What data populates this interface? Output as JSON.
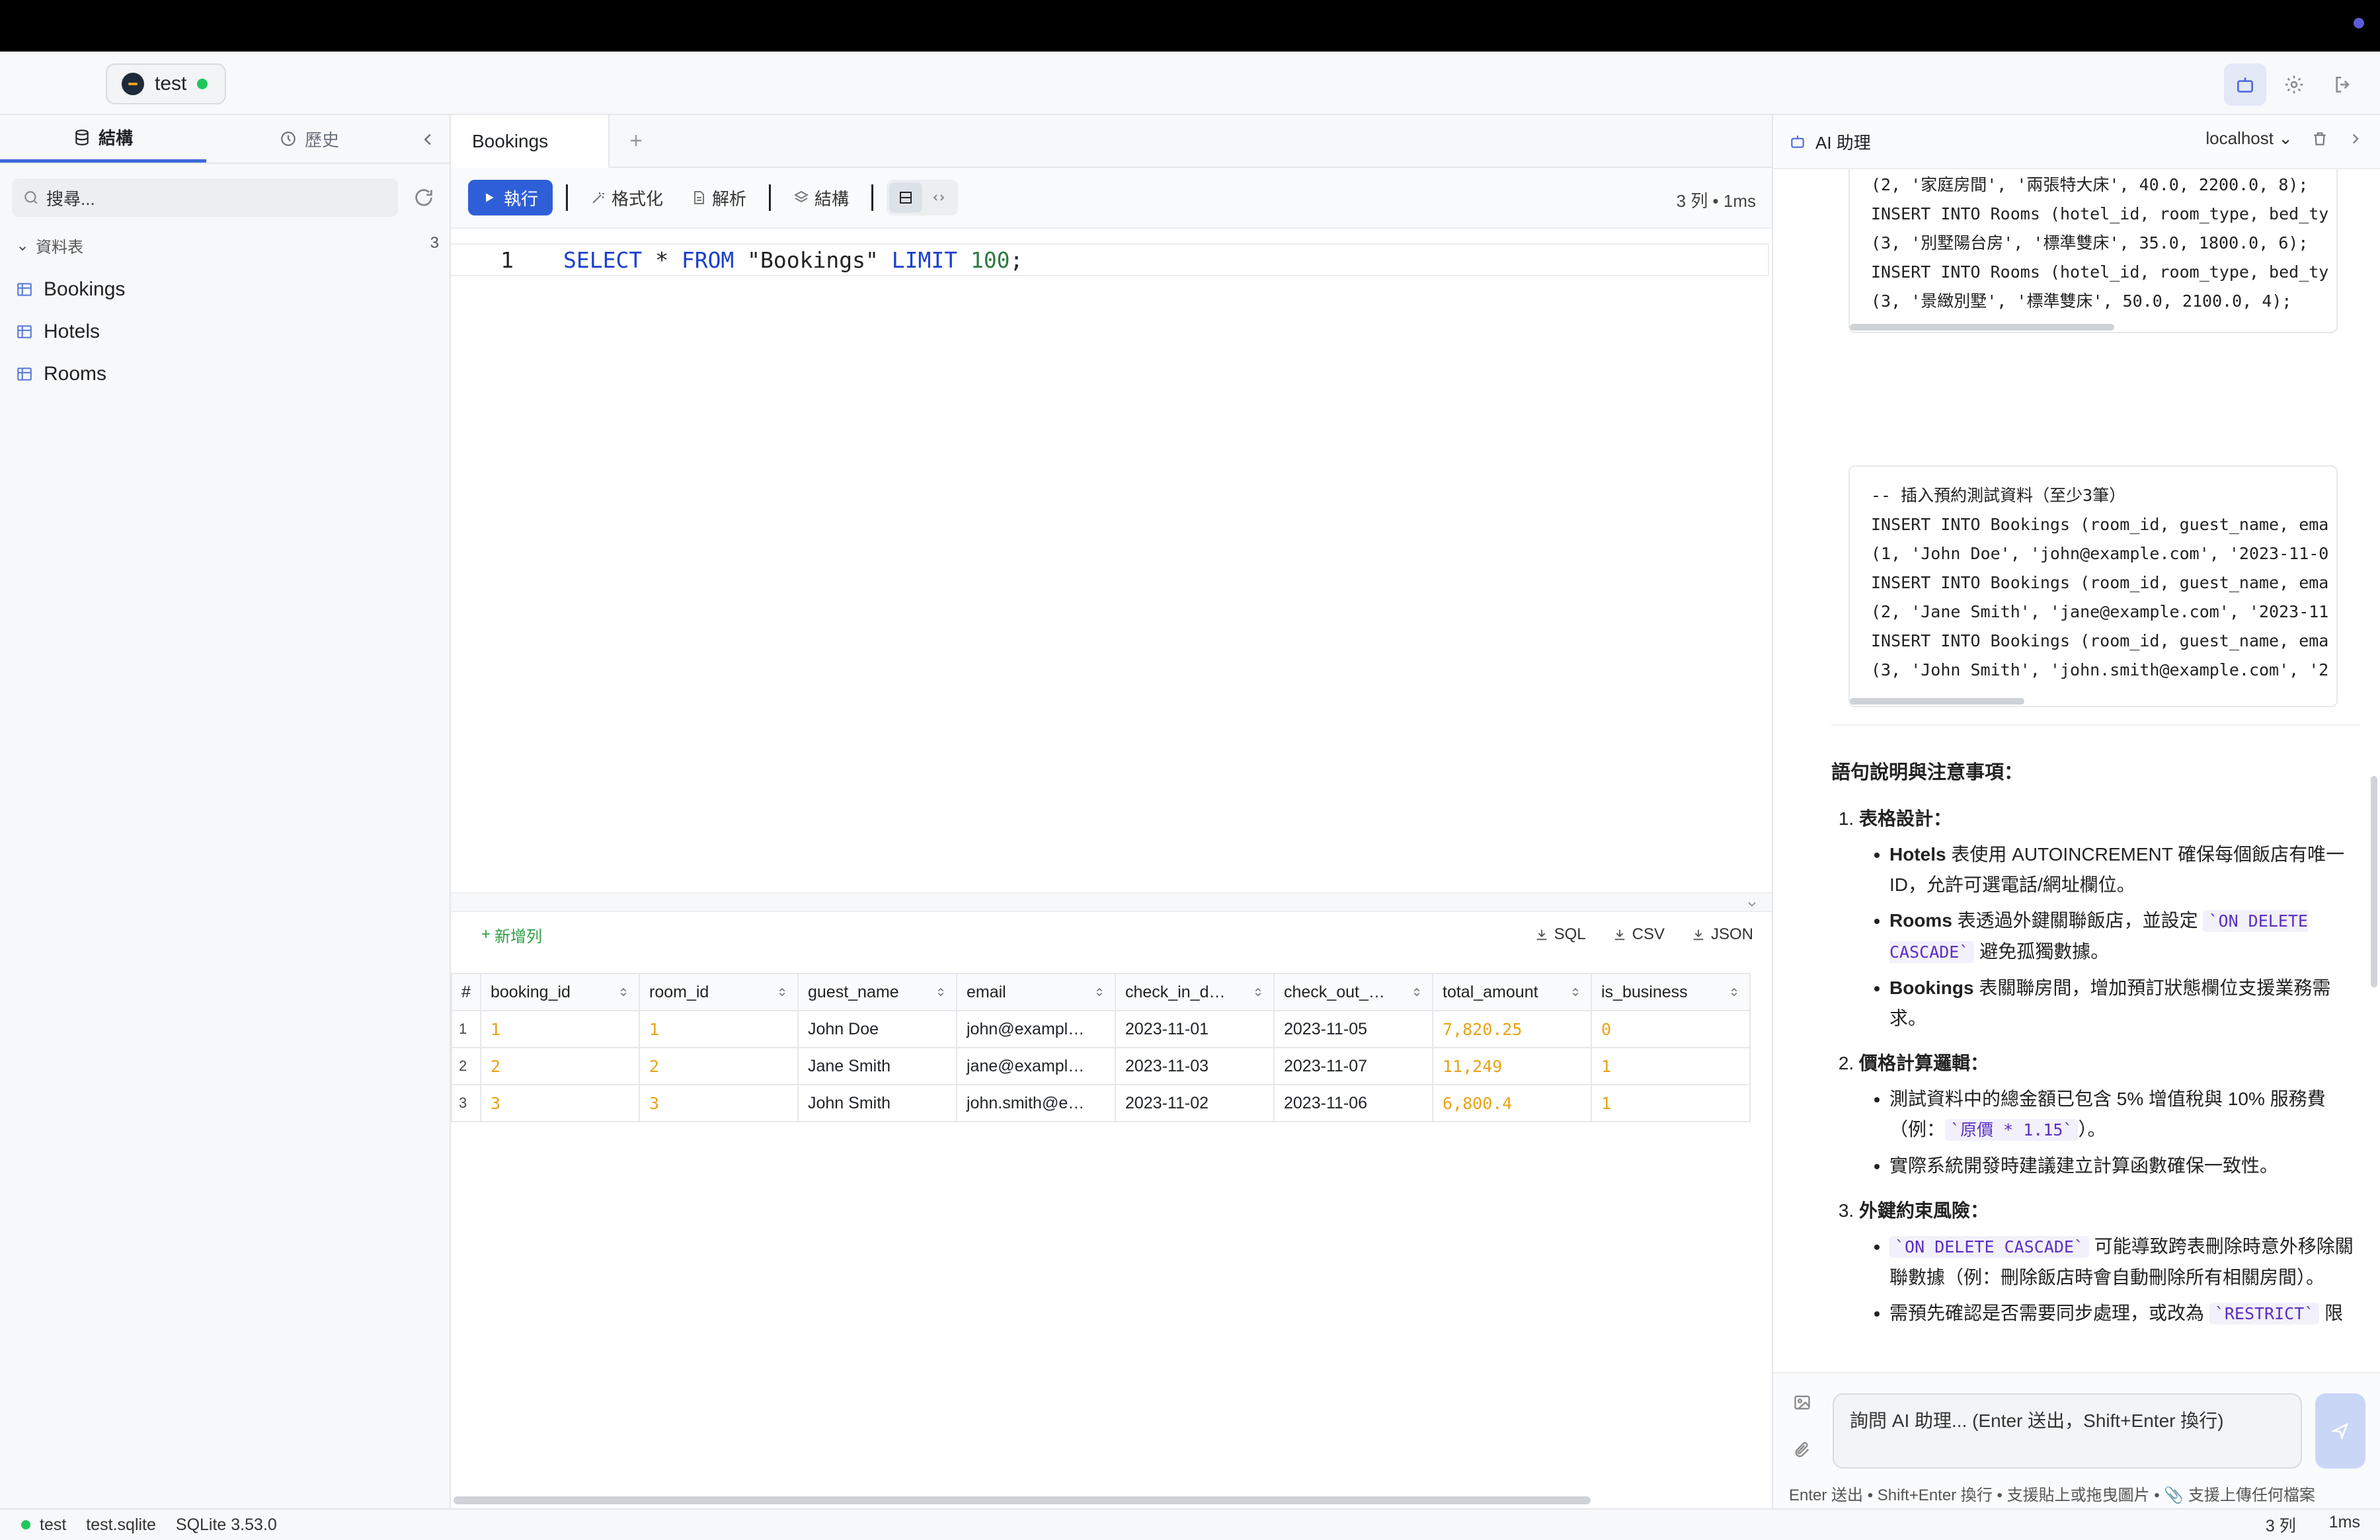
{
  "connection": {
    "name": "test"
  },
  "sidebar": {
    "tab_structure": "結構",
    "tab_history": "歷史",
    "search_placeholder": "搜尋...",
    "tables_heading": "資料表",
    "tables_count": "3",
    "tables": [
      {
        "label": "Bookings"
      },
      {
        "label": "Hotels"
      },
      {
        "label": "Rooms"
      }
    ]
  },
  "editor": {
    "tab": "Bookings",
    "run": "執行",
    "format": "格式化",
    "explain": "解析",
    "structure": "結構",
    "row_info": "3 列 • 1ms",
    "line_no": "1",
    "sql": {
      "select": "SELECT",
      "star": " * ",
      "from": "FROM",
      "table": " \"Bookings\" ",
      "limit": "LIMIT",
      "n": " 100",
      "semi": ";"
    }
  },
  "results": {
    "add_row": "新增列",
    "export_sql": "SQL",
    "export_csv": "CSV",
    "export_json": "JSON",
    "columns": [
      "#",
      "booking_id",
      "room_id",
      "guest_name",
      "email",
      "check_in_d…",
      "check_out_…",
      "total_amount",
      "is_business"
    ],
    "rows": [
      [
        "1",
        "1",
        "1",
        "John Doe",
        "john@exampl…",
        "2023-11-01",
        "2023-11-05",
        "7,820.25",
        "0"
      ],
      [
        "2",
        "2",
        "2",
        "Jane Smith",
        "jane@exampl…",
        "2023-11-03",
        "2023-11-07",
        "11,249",
        "1"
      ],
      [
        "3",
        "3",
        "3",
        "John Smith",
        "john.smith@e…",
        "2023-11-02",
        "2023-11-06",
        "6,800.4",
        "1"
      ]
    ]
  },
  "ai": {
    "title": "AI 助理",
    "server": "localhost",
    "code1": "(2, '家庭房間', '兩張特大床', 40.0, 2200.0, 8);\nINSERT INTO Rooms (hotel_id, room_type, bed_ty\n(3, '別墅陽台房', '標準雙床', 35.0, 1800.0, 6);\nINSERT INTO Rooms (hotel_id, room_type, bed_ty\n(3, '景緻別墅', '標準雙床', 50.0, 2100.0, 4);",
    "code2": "-- 插入預約測試資料（至少3筆）\nINSERT INTO Bookings (room_id, guest_name, ema\n(1, 'John Doe', 'john@example.com', '2023-11-0\nINSERT INTO Bookings (room_id, guest_name, ema\n(2, 'Jane Smith', 'jane@example.com', '2023-11\nINSERT INTO Bookings (room_id, guest_name, ema\n(3, 'John Smith', 'john.smith@example.com', '2",
    "heading": "語句說明與注意事項：",
    "s1_title": "表格設計",
    "s1_b1_bold": "Hotels",
    "s1_b1_text": " 表使用 AUTOINCREMENT 確保每個飯店有唯一ID，允許可選電話/網址欄位。",
    "s1_b2_bold": "Rooms",
    "s1_b2_text": " 表透過外鍵關聯飯店，並設定 ",
    "s1_b2_code": "`ON DELETE CASCADE`",
    "s1_b2_tail": " 避免孤獨數據。",
    "s1_b3_bold": "Bookings",
    "s1_b3_text": " 表關聯房間，增加預訂狀態欄位支援業務需求。",
    "s2_title": "價格計算邏輯",
    "s2_b1_text": "測試資料中的總金額已包含 5% 增值稅與 10% 服務費（例：",
    "s2_b1_code": "`原價 * 1.15`",
    "s2_b1_tail": "）。",
    "s2_b2_text": "實際系統開發時建議建立計算函數確保一致性。",
    "s3_title": "外鍵約束風險",
    "s3_b1_code": "`ON DELETE CASCADE`",
    "s3_b1_text": " 可能導致跨表刪除時意外移除關聯數據（例：刪除飯店時會自動刪除所有相關房間）。",
    "s3_b2_text": "需預先確認是否需要同步處理，或改為 ",
    "s3_b2_code": "`RESTRICT`",
    "s3_b2_tail": " 限",
    "input_placeholder": "詢問 AI 助理... (Enter 送出，Shift+Enter 換行)",
    "hint": "Enter 送出 • Shift+Enter 換行 • 支援貼上或拖曳圖片 • 📎 支援上傳任何檔案"
  },
  "status": {
    "conn": "test",
    "file": "test.sqlite",
    "engine": "SQLite 3.53.0",
    "rows": "3 列",
    "time": "1ms"
  }
}
